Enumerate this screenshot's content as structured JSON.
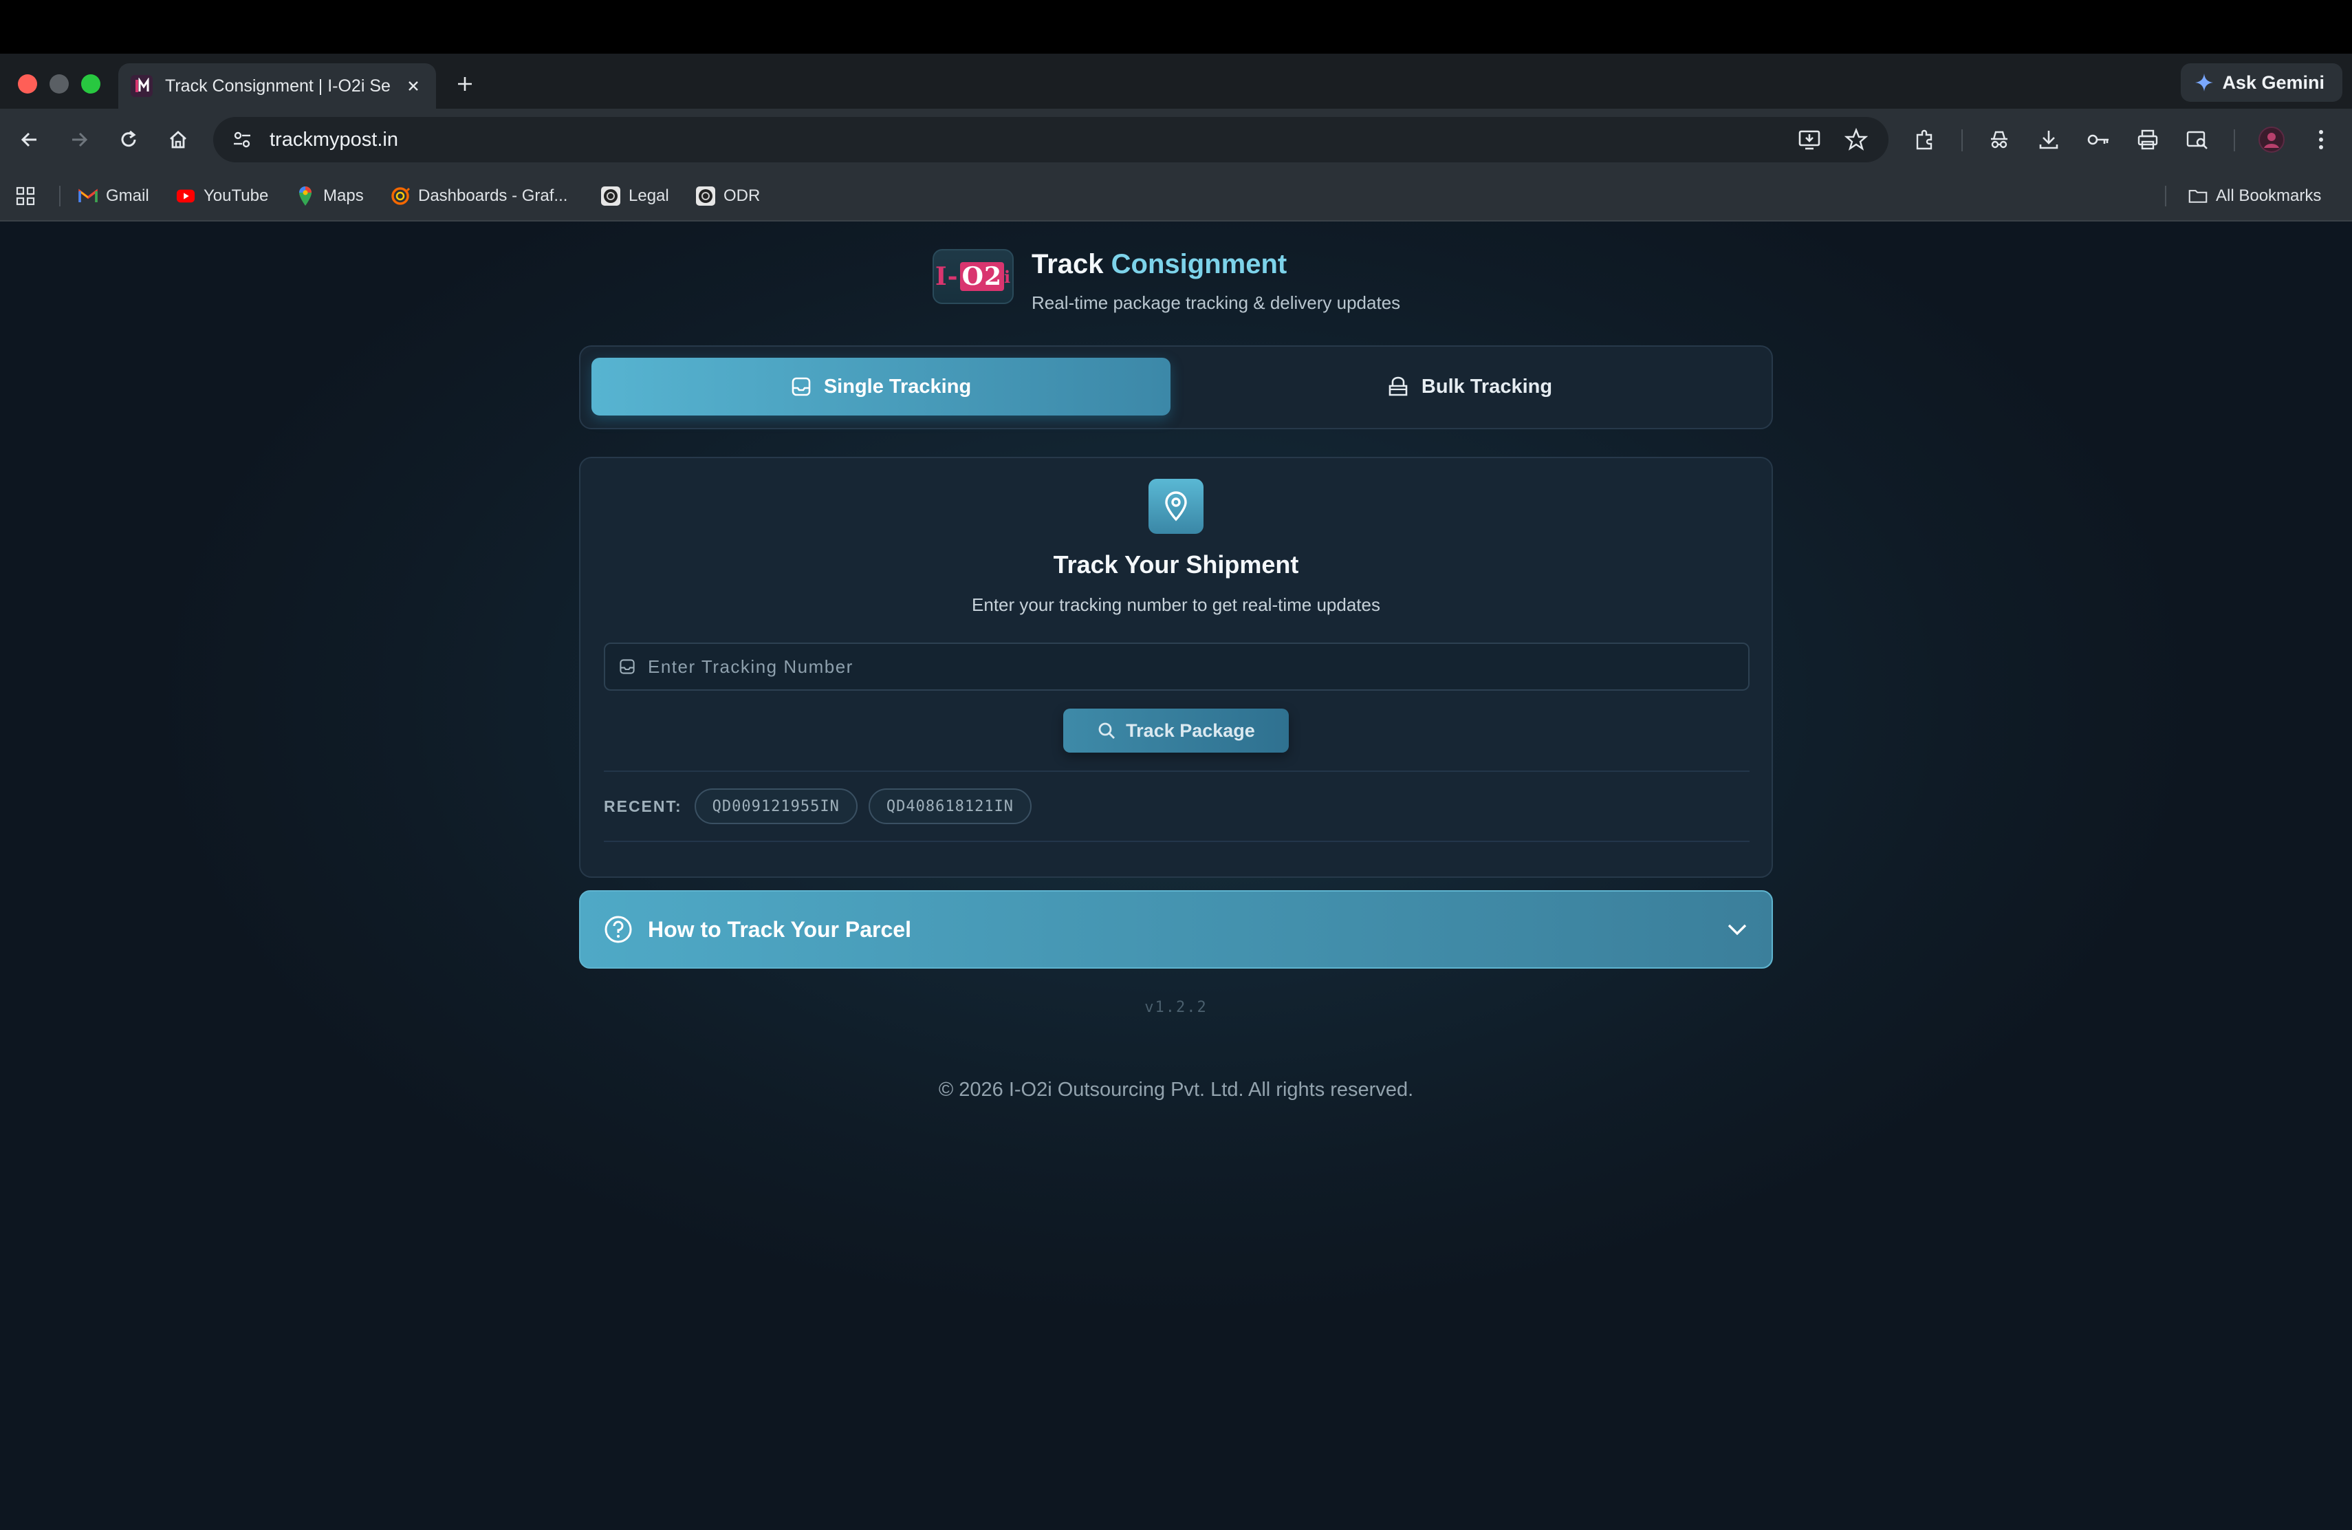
{
  "browser": {
    "tab_title": "Track Consignment | I-O2i Se",
    "new_tab_label": "+",
    "gemini_label": "Ask Gemini",
    "url": "trackmypost.in",
    "bookmarks": [
      {
        "label": "Gmail",
        "icon": "gmail-icon"
      },
      {
        "label": "YouTube",
        "icon": "youtube-icon"
      },
      {
        "label": "Maps",
        "icon": "maps-icon"
      },
      {
        "label": "Dashboards - Graf...",
        "icon": "grafana-icon"
      },
      {
        "label": "Legal",
        "icon": "legal-icon"
      },
      {
        "label": "ODR",
        "icon": "odr-icon"
      }
    ],
    "all_bookmarks_label": "All Bookmarks"
  },
  "header": {
    "logo_text_left": "I-",
    "logo_text_right": "O2",
    "logo_text_tail": "i",
    "title_main": "Track ",
    "title_accent": "Consignment",
    "subtitle": "Real-time package tracking & delivery updates"
  },
  "mode_tabs": {
    "single_label": "Single Tracking",
    "bulk_label": "Bulk Tracking",
    "active": "single"
  },
  "tracker": {
    "title": "Track Your Shipment",
    "subtitle": "Enter your tracking number to get real-time updates",
    "input_placeholder": "Enter Tracking Number",
    "input_value": "",
    "button_label": "Track Package",
    "recent_label": "RECENT:",
    "recent": [
      "QD009121955IN",
      "QD408618121IN"
    ]
  },
  "help": {
    "title": "How to Track Your Parcel"
  },
  "version": "v1.2.2",
  "footer": "© 2026 I-O2i Outsourcing Pvt. Ltd. All rights reserved.",
  "colors": {
    "accent": "#57b4d1",
    "accent_dark": "#3c88a8",
    "brand_pink": "#d9356f",
    "page_bg": "#0f1b26"
  }
}
